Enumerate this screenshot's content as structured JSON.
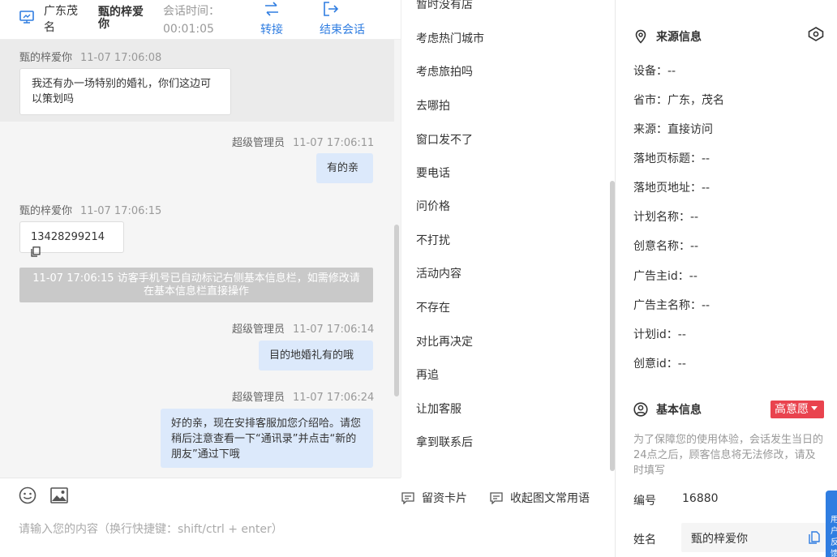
{
  "chat_header": {
    "location": "广东茂名",
    "visitor_name": "甄的梓爱你",
    "session_time_label": "会话时间：",
    "session_time": "00:01:05",
    "transfer_label": "转接",
    "end_label": "结束会话"
  },
  "messages": {
    "m1": {
      "sender": "甄的梓爱你",
      "time": "11-07 17:06:08",
      "text": "我还有办一场特别的婚礼，你们这边可以策划吗"
    },
    "m2": {
      "sender": "超级管理员",
      "time": "11-07 17:06:11",
      "text": "有的亲"
    },
    "m3": {
      "sender": "甄的梓爱你",
      "time": "11-07 17:06:15",
      "text": "13428299214"
    },
    "system": "11-07 17:06:15 访客手机号已自动标记右侧基本信息栏，如需修改请在基本信息栏直接操作",
    "m4": {
      "sender": "超级管理员",
      "time": "11-07 17:06:14",
      "text": "目的地婚礼有的哦"
    },
    "m5": {
      "sender": "超级管理员",
      "time": "11-07 17:06:24",
      "text": "好的亲，现在安排客服加您介绍哈。请您稍后注意查看一下“通讯录”并点击“新的朋友”通过下哦"
    }
  },
  "input": {
    "placeholder": "请输入您的内容（换行快捷键：shift/ctrl + enter）"
  },
  "quick_replies": [
    "暂时没有店",
    "考虑热门城市",
    "考虑旅拍吗",
    "去哪拍",
    "窗口发不了",
    "要电话",
    "问价格",
    "不打扰",
    "活动内容",
    "不存在",
    "对比再决定",
    "再追",
    "让加客服",
    "拿到联系后"
  ],
  "quick_tools": {
    "card_label": "留资卡片",
    "collapse_label": "收起图文常用语"
  },
  "source_info": {
    "title": "来源信息",
    "fields": [
      "设备：--",
      "省市：广东，茂名",
      "来源：直接访问",
      "落地页标题：--",
      "落地页地址：--",
      "计划名称：--",
      "创意名称：--",
      "广告主id：--",
      "广告主名称：--",
      "计划id：--",
      "创意id：--"
    ]
  },
  "basic_info": {
    "title": "基本信息",
    "intent": "高意愿",
    "note": "为了保障您的使用体验，会话发生当日的24点之后，顾客信息将无法修改，请及时填写",
    "id_label": "编号",
    "id_value": "16880",
    "name_label": "姓名",
    "name_value": "甄的梓爱你"
  },
  "float_tab": {
    "text": "用户反馈"
  },
  "colors": {
    "accent": "#2f7de1",
    "intent_badge": "#e9434e",
    "bubble_right": "#dce9fb"
  }
}
